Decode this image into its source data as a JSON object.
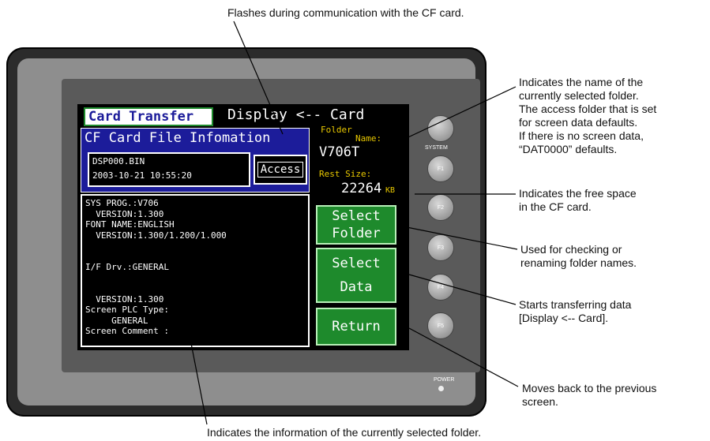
{
  "callouts": {
    "top": "Flashes during communication with the CF card.",
    "folder_name": [
      "Indicates the name of the",
      "currently selected folder.",
      "The access folder that is set",
      "for screen data defaults.",
      "If there is no screen data,",
      "“DAT0000” defaults."
    ],
    "free_space": [
      "Indicates the free space",
      "in the CF card."
    ],
    "select_folder": [
      "Used for checking or",
      "renaming folder names."
    ],
    "select_data": [
      "Starts transferring data",
      "[Display <-- Card]."
    ],
    "return": [
      "Moves back to the previous",
      "screen."
    ],
    "bottom": "Indicates the information of the currently selected folder."
  },
  "screen": {
    "title": "Card Transfer",
    "direction": "Display <-- Card",
    "info_title": "CF Card File Infomation",
    "file_name": "DSP000.BIN",
    "file_date": "2003-10-21 10:55:20",
    "access_label": "Access",
    "folder_label": "Folder",
    "name_label": "Name:",
    "folder_value": "V706T",
    "rest_label": "Rest Size:",
    "rest_value": "22264",
    "rest_unit": "KB",
    "info_lines": [
      "SYS PROG.:V706",
      "  VERSION:1.300",
      "FONT NAME:ENGLISH",
      "  VERSION:1.300/1.200/1.000",
      "",
      "",
      "I/F Drv.:GENERAL",
      "",
      "",
      "  VERSION:1.300",
      "Screen PLC Type:",
      "     GENERAL",
      "Screen Comment :"
    ],
    "buttons": {
      "select_folder": [
        "Select",
        "Folder"
      ],
      "select_data": [
        "Select",
        "Data"
      ],
      "return": "Return"
    }
  },
  "keys": {
    "system_label": "SYSTEM",
    "f1": "F1",
    "f2": "F2",
    "f3": "F3",
    "f4": "F4",
    "f5": "F5",
    "power_label": "POWER"
  },
  "colors": {
    "title_green": "#1e8a2c",
    "info_blue": "#1c1c9a",
    "label_yellow": "#e8c800",
    "screen_bg": "#000000"
  }
}
